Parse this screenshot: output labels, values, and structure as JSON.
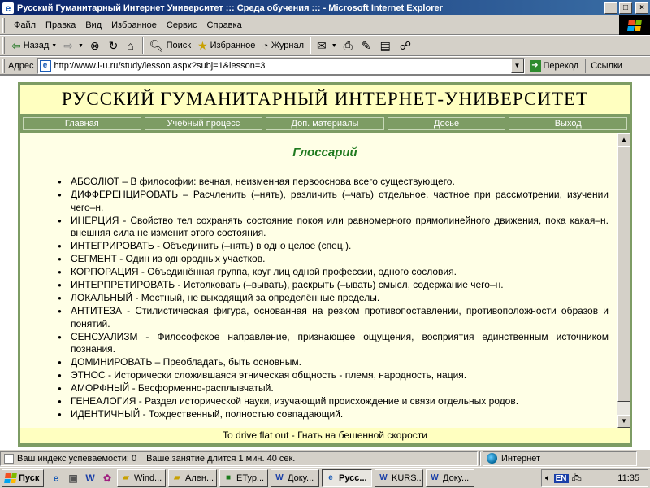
{
  "window": {
    "title": "Русский Гуманитарный Интернет Университет ::: Среда обучения ::: - Microsoft Internet Explorer",
    "minimize": "_",
    "maximize": "□",
    "close": "×"
  },
  "menu": [
    "Файл",
    "Правка",
    "Вид",
    "Избранное",
    "Сервис",
    "Справка"
  ],
  "toolbar": {
    "back": "Назад",
    "search": "Поиск",
    "favorites": "Избранное",
    "history": "Журнал"
  },
  "address": {
    "label": "Адрес",
    "url": "http://www.i-u.ru/study/lesson.aspx?subj=1&lesson=3",
    "go": "Переход",
    "links": "Ссылки"
  },
  "page": {
    "banner": "РУССКИЙ ГУМАНИТАРНЫЙ ИНТЕРНЕТ-УНИВЕРСИТЕТ",
    "nav": [
      "Главная",
      "Учебный процесс",
      "Доп. материалы",
      "Досье",
      "Выход"
    ],
    "section_title": "Глоссарий",
    "terms": [
      "АБСОЛЮТ – В философии: вечная, неизменная первооснова всего существующего.",
      "ДИФФЕРЕНЦИРОВАТЬ – Расчленить (–нять), различить (–чать) отдельное, частное при рассмотрении, изучении чего–н.",
      "ИНЕРЦИЯ - Свойство тел сохранять состояние покоя или равномерного прямолинейного движения, пока какая–н. внешняя сила не изменит этого состояния.",
      "ИНТЕГРИРОВАТЬ - Объединить (–нять) в одно целое (спец.).",
      "СЕГМЕНТ - Один из однородных участков.",
      "КОРПОРАЦИЯ - Объединённая группа, круг лиц одной профессии, одного сословия.",
      "ИНТЕРПРЕТИРОВАТЬ - Истолковать (–вывать), раскрыть (–ывать) смысл, содержание чего–н.",
      "ЛОКАЛЬНЫЙ - Местный, не выходящий за определённые пределы.",
      "АНТИТЕЗА - Стилистическая фигура, основанная на резком противопоставлении, противоположности образов и понятий.",
      "СЕНСУАЛИЗМ - Философское направление, признающее ощущения, восприятия единственным источником познания.",
      "ДОМИНИРОВАТЬ – Преобладать, быть основным.",
      "ЭТНОС - Исторически сложившаяся этническая общность - племя, народность, нация.",
      "АМОРФНЫЙ - Бесформенно-расплывчатый.",
      "ГЕНЕАЛОГИЯ - Раздел исторической науки, изучающий происхождение и связи отдельных родов.",
      "ИДЕНТИЧНЫЙ - Тождественный, полностью совпадающий."
    ],
    "footer": "To drive flat out - Гнать на бешенной скорости"
  },
  "status": {
    "index": "Ваш индекс успеваемости: 0",
    "duration": "Ваше занятие длится 1 мин. 40 сек.",
    "zone": "Интернет"
  },
  "taskbar": {
    "start": "Пуск",
    "tasks": [
      "Wind...",
      "Ален...",
      "ЕТур...",
      "Доку...",
      "Русс...",
      "KURS...",
      "Доку..."
    ],
    "lang": "EN",
    "clock": "11:35"
  }
}
